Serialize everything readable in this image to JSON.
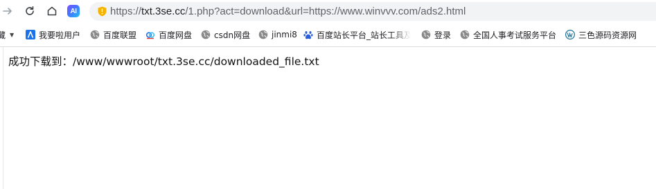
{
  "toolbar": {
    "forward_icon": "arrow-right-icon",
    "reload_icon": "reload-icon",
    "home_icon": "home-icon",
    "ai_badge_text": "AI",
    "security_icon": "shield-warning-icon",
    "url_scheme": "https://",
    "url_host": "txt.3se.cc",
    "url_rest": "/1.php?act=download&url=https://www.winvvv.com/ads2.html"
  },
  "bookmarks": {
    "overflow_label": "藏",
    "items": [
      {
        "label": "我要啦用户",
        "icon": "blue-a-icon"
      },
      {
        "label": "百度联盟",
        "icon": "globe-icon"
      },
      {
        "label": "百度网盘",
        "icon": "baidu-netdisk-icon"
      },
      {
        "label": "csdn网盘",
        "icon": "globe-icon"
      },
      {
        "label": "jinmi8",
        "icon": "globe-icon"
      },
      {
        "label": "百度站长平台_站长工具及",
        "icon": "baidu-paw-icon"
      },
      {
        "label": "登录",
        "icon": "globe-icon"
      },
      {
        "label": "全国人事考试服务平台",
        "icon": "globe-icon"
      },
      {
        "label": "三色源码资源网",
        "icon": "wordpress-icon"
      }
    ]
  },
  "page": {
    "message": "成功下载到：/www/wwwroot/txt.3se.cc/downloaded_file.txt"
  },
  "colors": {
    "omnibox_bg": "#f1f3f4",
    "security_shield": "#f5b400",
    "bookmark_blue": "#1a73e8"
  }
}
